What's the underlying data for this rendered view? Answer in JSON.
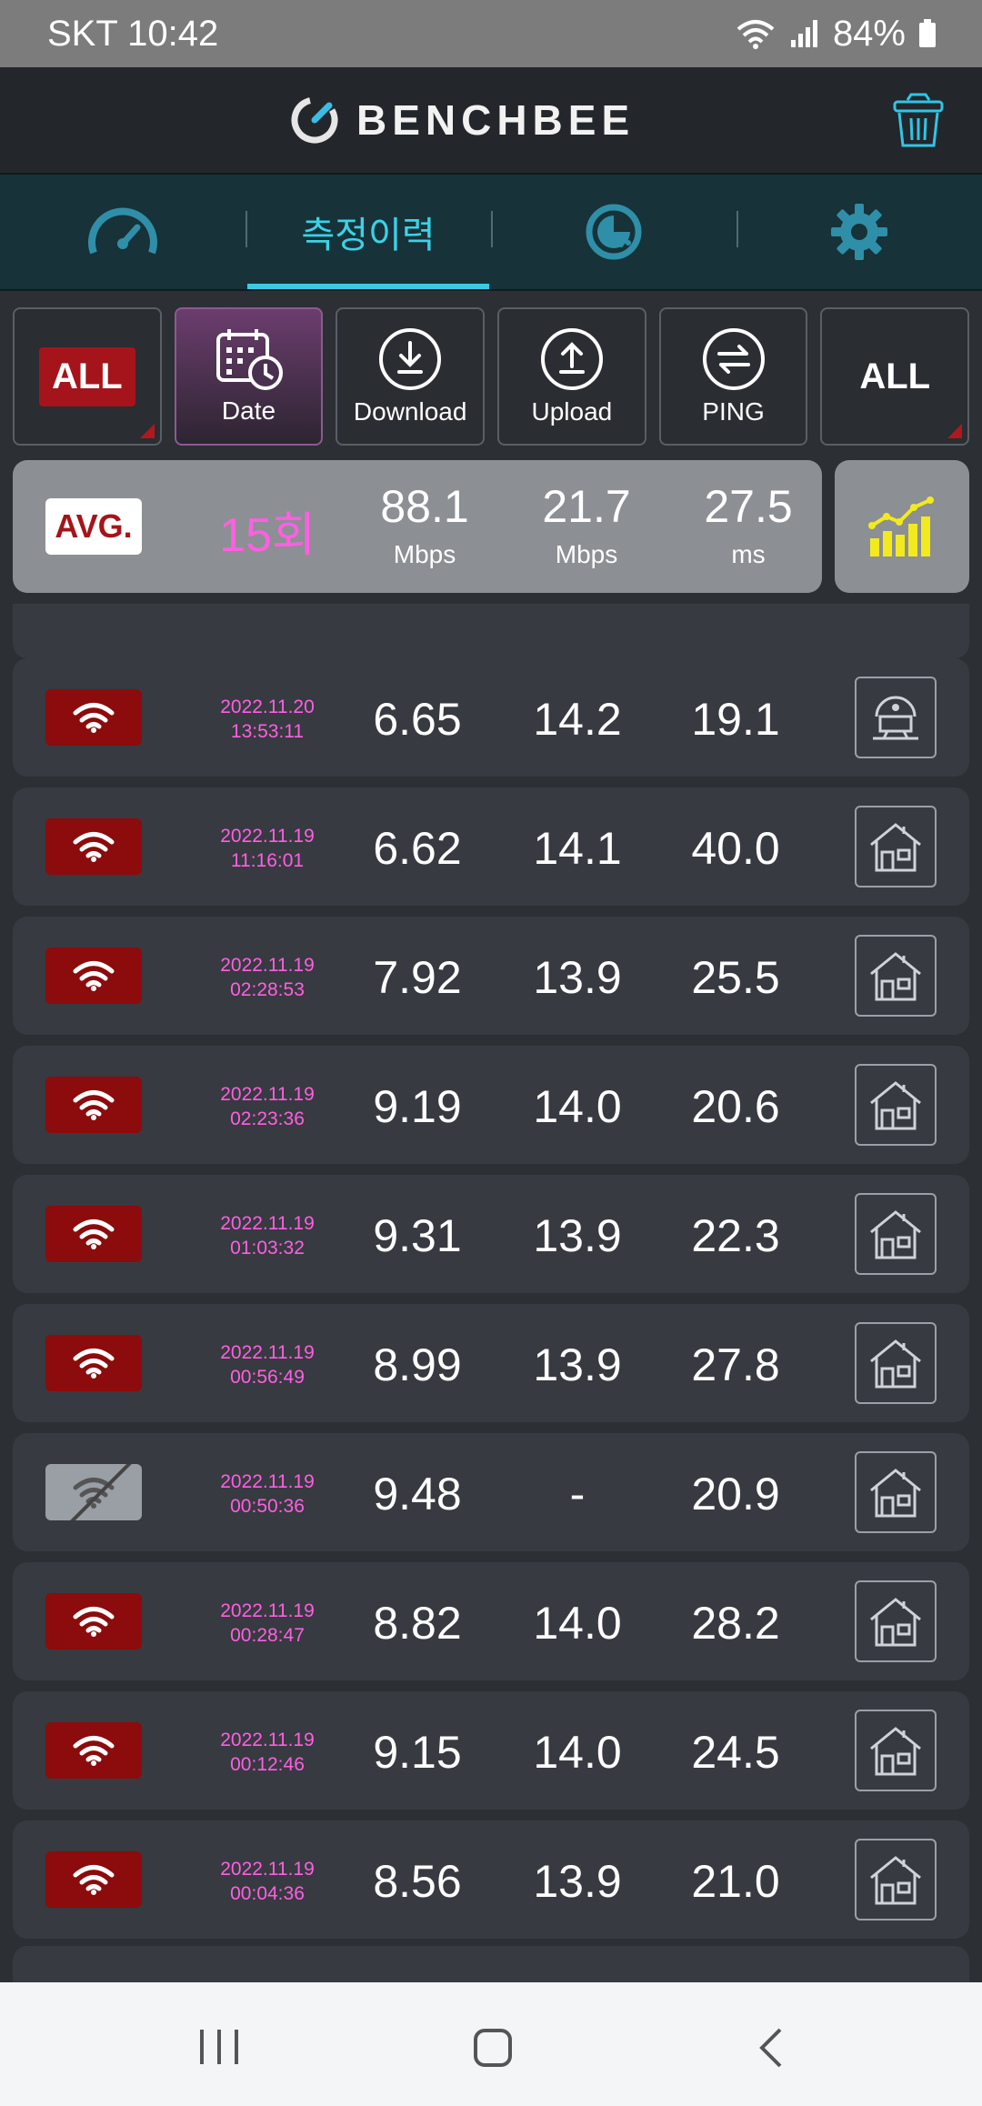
{
  "status": {
    "carrier_time": "SKT 10:42",
    "battery": "84%"
  },
  "app": {
    "title": "BENCHBEE"
  },
  "tabs": [
    {
      "icon": "speedometer-icon",
      "label": ""
    },
    {
      "icon": "",
      "label": "측정이력"
    },
    {
      "icon": "pie-chart-icon",
      "label": ""
    },
    {
      "icon": "gear-icon",
      "label": ""
    }
  ],
  "filters": {
    "network_all": "ALL",
    "date": "Date",
    "download": "Download",
    "upload": "Upload",
    "ping": "PING",
    "place_all": "ALL"
  },
  "average": {
    "badge": "AVG.",
    "count": "15회",
    "download": "88.1",
    "download_unit": "Mbps",
    "upload": "21.7",
    "upload_unit": "Mbps",
    "ping": "27.5",
    "ping_unit": "ms"
  },
  "records": [
    {
      "date": "2022.11.20",
      "time": "13:53:11",
      "download": "6.65",
      "upload": "14.2",
      "ping": "19.1",
      "network": "wifi",
      "place": "lab"
    },
    {
      "date": "2022.11.19",
      "time": "11:16:01",
      "download": "6.62",
      "upload": "14.1",
      "ping": "40.0",
      "network": "wifi",
      "place": "home"
    },
    {
      "date": "2022.11.19",
      "time": "02:28:53",
      "download": "7.92",
      "upload": "13.9",
      "ping": "25.5",
      "network": "wifi",
      "place": "home"
    },
    {
      "date": "2022.11.19",
      "time": "02:23:36",
      "download": "9.19",
      "upload": "14.0",
      "ping": "20.6",
      "network": "wifi",
      "place": "home"
    },
    {
      "date": "2022.11.19",
      "time": "01:03:32",
      "download": "9.31",
      "upload": "13.9",
      "ping": "22.3",
      "network": "wifi",
      "place": "home"
    },
    {
      "date": "2022.11.19",
      "time": "00:56:49",
      "download": "8.99",
      "upload": "13.9",
      "ping": "27.8",
      "network": "wifi",
      "place": "home"
    },
    {
      "date": "2022.11.19",
      "time": "00:50:36",
      "download": "9.48",
      "upload": "-",
      "ping": "20.9",
      "network": "wifi-off",
      "place": "home"
    },
    {
      "date": "2022.11.19",
      "time": "00:28:47",
      "download": "8.82",
      "upload": "14.0",
      "ping": "28.2",
      "network": "wifi",
      "place": "home"
    },
    {
      "date": "2022.11.19",
      "time": "00:12:46",
      "download": "9.15",
      "upload": "14.0",
      "ping": "24.5",
      "network": "wifi",
      "place": "home"
    },
    {
      "date": "2022.11.19",
      "time": "00:04:36",
      "download": "8.56",
      "upload": "13.9",
      "ping": "21.0",
      "network": "wifi",
      "place": "home"
    }
  ],
  "colors": {
    "accent": "#39d3e8",
    "date_text": "#ff5fe2",
    "brand_red": "#a5141b"
  }
}
